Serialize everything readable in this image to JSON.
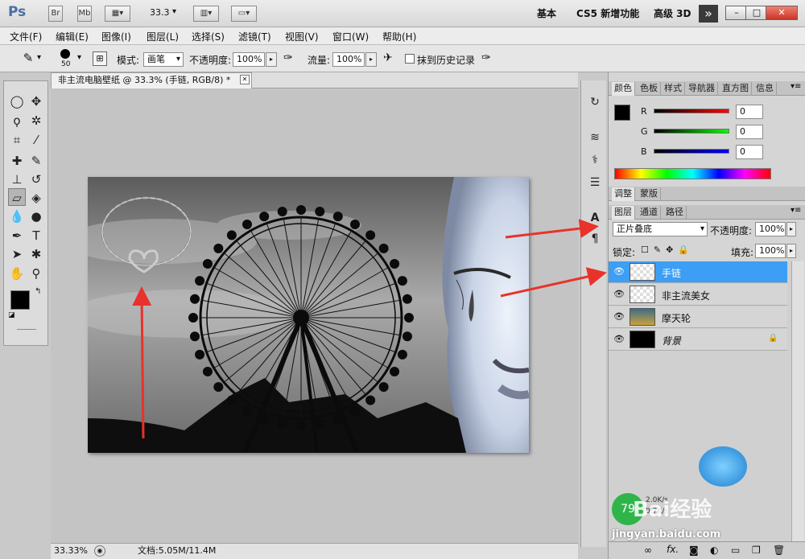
{
  "titlebar": {
    "app_logo": "Ps",
    "bridge_btn": "Br",
    "minibridge_btn": "Mb",
    "zoom_value": "33.3",
    "workspaces": [
      "基本",
      "CS5 新增功能",
      "高级 3D"
    ],
    "more_icon": "»",
    "minimize_icon": "–",
    "maximize_icon": "□",
    "close_icon": "✕"
  },
  "menu": [
    "文件(F)",
    "编辑(E)",
    "图像(I)",
    "图层(L)",
    "选择(S)",
    "滤镜(T)",
    "视图(V)",
    "窗口(W)",
    "帮助(H)"
  ],
  "options": {
    "brush_size": "50",
    "mode_label": "模式:",
    "mode_value": "画笔",
    "opacity_label": "不透明度:",
    "opacity_value": "100%",
    "flow_label": "流量:",
    "flow_value": "100%",
    "history_label": "抹到历史记录"
  },
  "document": {
    "tab_title": "非主流电脑壁纸 @ 33.3% (手链, RGB/8) *",
    "tab_close": "✕"
  },
  "status": {
    "zoom": "33.33%",
    "doc_size": "文档:5.05M/11.4M"
  },
  "color_panel": {
    "tabs": [
      "颜色",
      "色板",
      "样式",
      "导航器",
      "直方图",
      "信息"
    ],
    "channels": [
      {
        "label": "R",
        "value": "0",
        "gradient": "#ff0000"
      },
      {
        "label": "G",
        "value": "0",
        "gradient": "#00ff00"
      },
      {
        "label": "B",
        "value": "0",
        "gradient": "#0000ff"
      }
    ]
  },
  "adjust_panel": {
    "tabs": [
      "调整",
      "蒙版"
    ]
  },
  "layers_panel": {
    "tabs": [
      "图层",
      "通道",
      "路径"
    ],
    "blend_mode": "正片叠底",
    "opacity_label": "不透明度:",
    "opacity_value": "100%",
    "lock_label": "锁定:",
    "fill_label": "填充:",
    "fill_value": "100%",
    "layers": [
      {
        "name": "手链",
        "selected": true
      },
      {
        "name": "非主流美女",
        "selected": false
      },
      {
        "name": "摩天轮",
        "selected": false
      },
      {
        "name": "背景",
        "selected": false
      }
    ],
    "footer_icons": [
      "link-icon",
      "fx-icon",
      "mask-icon",
      "adjust-icon",
      "folder-icon",
      "new-layer-icon",
      "trash-icon"
    ]
  },
  "watermark": {
    "brand": "Bai经验",
    "url": "jingyan.baidu.com",
    "speed_up": "2.0K/s",
    "speed_down": "0.7K/s",
    "badge": "79"
  },
  "colors": {
    "selected_layer": "#3c9ef4",
    "arrow": "#e8322b",
    "foreground": "#000000",
    "background": "#ffffff"
  }
}
